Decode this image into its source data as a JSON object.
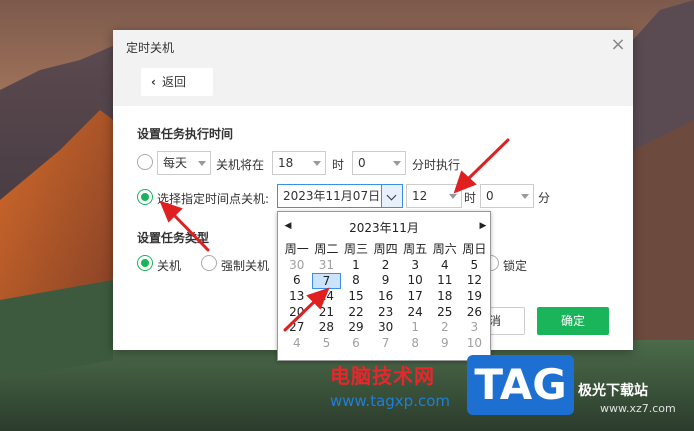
{
  "dialog": {
    "title": "定时关机",
    "close_symbol": "×",
    "back_label": "返回"
  },
  "task_time": {
    "section_title": "设置任务执行时间",
    "opt1": {
      "freq_value": "每天",
      "label_before": "关机将在",
      "hour_value": "18",
      "hour_unit": "时",
      "minute_value": "0",
      "after_label": "分时执行"
    },
    "opt2": {
      "label": "选择指定时间点关机:",
      "date_value": "2023年11月07日",
      "hour_value": "12",
      "hour_unit": "时",
      "minute_value": "0",
      "minute_unit": "分"
    }
  },
  "task_type": {
    "section_title": "设置任务类型",
    "options": [
      "关机",
      "强制关机",
      "锁定"
    ]
  },
  "buttons": {
    "cancel_label": "取消",
    "ok_label": "确定"
  },
  "calendar": {
    "title": "2023年11月",
    "prev_symbol": "◀",
    "next_symbol": "▶",
    "weekdays": [
      "周一",
      "周二",
      "周三",
      "周四",
      "周五",
      "周六",
      "周日"
    ],
    "weeks": [
      [
        "30",
        "31",
        "1",
        "2",
        "3",
        "4",
        "5"
      ],
      [
        "6",
        "7",
        "8",
        "9",
        "10",
        "11",
        "12"
      ],
      [
        "13",
        "14",
        "15",
        "16",
        "17",
        "18",
        "19"
      ],
      [
        "20",
        "21",
        "22",
        "23",
        "24",
        "25",
        "26"
      ],
      [
        "27",
        "28",
        "29",
        "30",
        "1",
        "2",
        "3"
      ],
      [
        "4",
        "5",
        "6",
        "7",
        "8",
        "9",
        "10"
      ]
    ],
    "selected_day": "7"
  },
  "watermark": {
    "site_name": "电脑技术网",
    "site_url": "www.tagxp.com",
    "logo_text": "TAG",
    "partner_name": "极光下载站",
    "partner_url": "www.xz7.com"
  },
  "colors": {
    "accent_green": "#1ab45a",
    "focus_blue": "#3c8ee6",
    "arrow_red": "#e02020"
  }
}
